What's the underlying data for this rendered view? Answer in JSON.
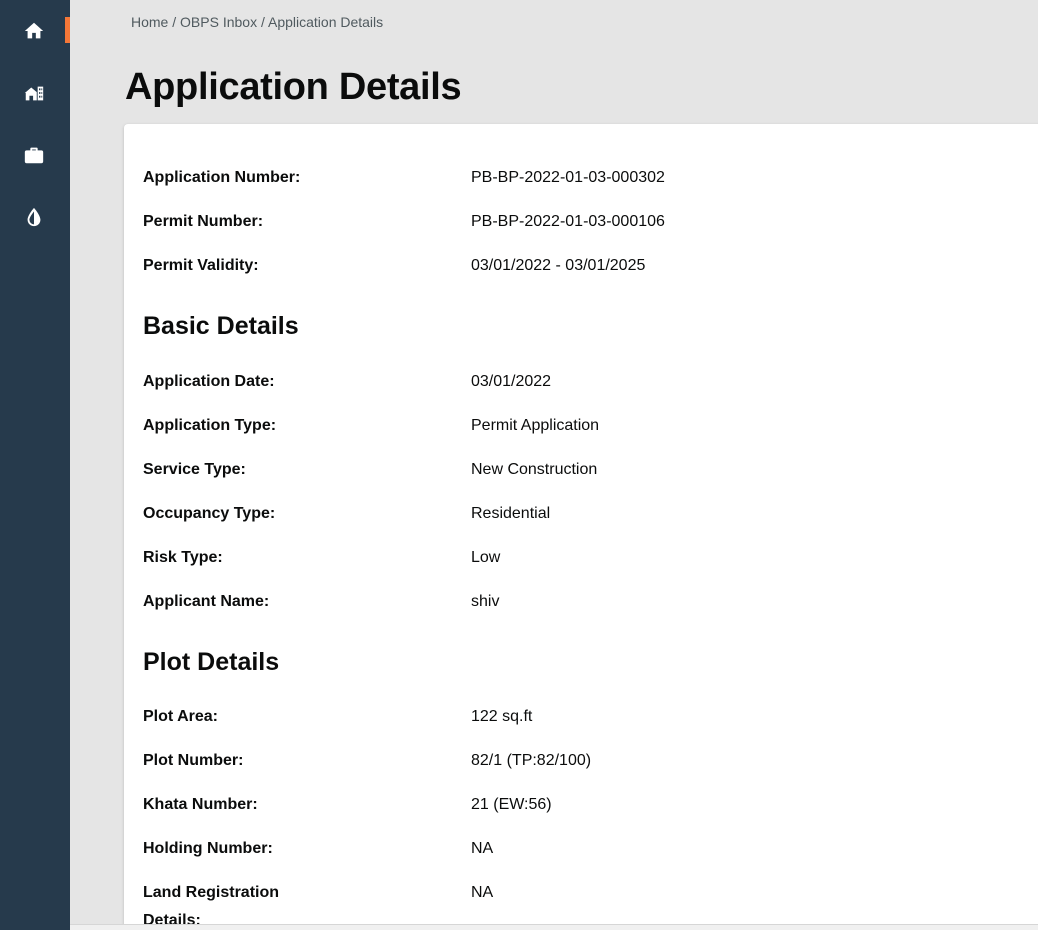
{
  "sidebar": {
    "items": [
      {
        "icon": "home-icon",
        "active": true
      },
      {
        "icon": "building-icon",
        "active": false
      },
      {
        "icon": "briefcase-icon",
        "active": false
      },
      {
        "icon": "water-drop-icon",
        "active": false
      }
    ],
    "accent_color": "#f47738",
    "background_color": "#263a4c"
  },
  "breadcrumb": {
    "home": "Home",
    "inbox": "OBPS Inbox",
    "current": "Application Details",
    "separator": "/"
  },
  "page_title": "Application Details",
  "summary": [
    {
      "label": "Application Number:",
      "value": "PB-BP-2022-01-03-000302"
    },
    {
      "label": "Permit Number:",
      "value": "PB-BP-2022-01-03-000106"
    },
    {
      "label": "Permit Validity:",
      "value": "03/01/2022 - 03/01/2025"
    }
  ],
  "basic_details": {
    "title": "Basic Details",
    "rows": [
      {
        "label": "Application Date:",
        "value": "03/01/2022"
      },
      {
        "label": "Application Type:",
        "value": "Permit Application"
      },
      {
        "label": "Service Type:",
        "value": "New Construction"
      },
      {
        "label": "Occupancy Type:",
        "value": "Residential"
      },
      {
        "label": "Risk Type:",
        "value": "Low"
      },
      {
        "label": "Applicant Name:",
        "value": "shiv"
      }
    ]
  },
  "plot_details": {
    "title": "Plot Details",
    "rows": [
      {
        "label": "Plot Area:",
        "value": "122 sq.ft"
      },
      {
        "label": "Plot Number:",
        "value": "82/1 (TP:82/100)"
      },
      {
        "label": "Khata Number:",
        "value": "21 (EW:56)"
      },
      {
        "label": "Holding Number:",
        "value": "NA"
      },
      {
        "label": "Land Registration Details:",
        "value": "NA"
      }
    ]
  }
}
